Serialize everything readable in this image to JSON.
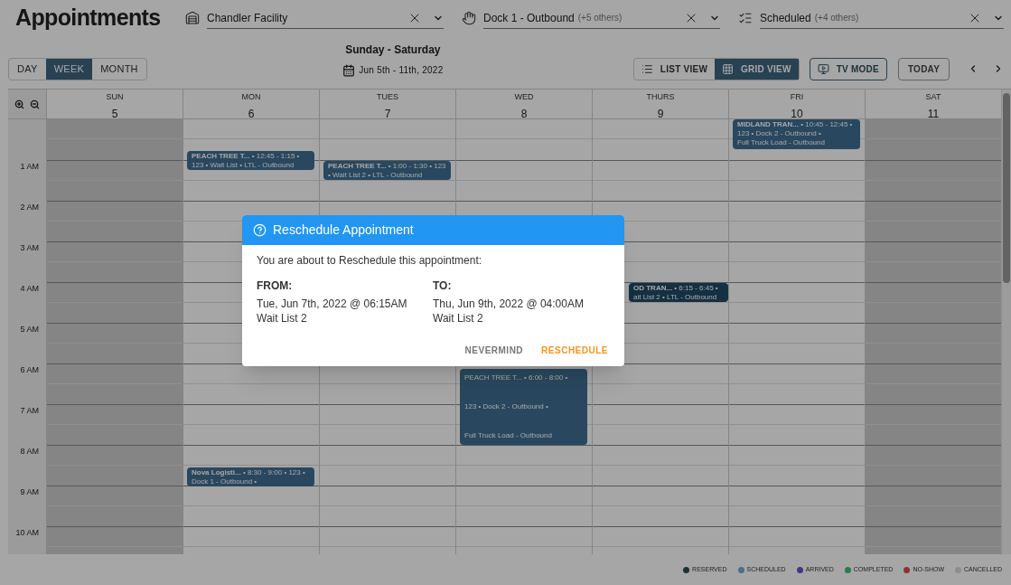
{
  "title": "Appointments",
  "filters": [
    {
      "kind": "facility",
      "value": "Chandler Facility"
    },
    {
      "kind": "dock",
      "value": "Dock 1 - Outbound",
      "extra": "(+5 others)"
    },
    {
      "kind": "status",
      "value": "Scheduled",
      "extra": "(+4 others)"
    }
  ],
  "range_tabs": [
    {
      "label": "DAY",
      "selected": false
    },
    {
      "label": "WEEK",
      "selected": true
    },
    {
      "label": "MONTH",
      "selected": false
    }
  ],
  "range_title": "Sunday - Saturday",
  "range_dates": "Jun 5th - 11th, 2022",
  "view_tabs": [
    {
      "kind": "list",
      "label": "LIST VIEW",
      "selected": false
    },
    {
      "kind": "grid",
      "label": "GRID VIEW",
      "selected": true
    }
  ],
  "tv_mode": "TV MODE",
  "today": "TODAY",
  "days": [
    {
      "name": "SUN",
      "date": "5",
      "closed": true
    },
    {
      "name": "MON",
      "date": "6",
      "closed": false
    },
    {
      "name": "TUES",
      "date": "7",
      "closed": false
    },
    {
      "name": "WED",
      "date": "8",
      "closed": false
    },
    {
      "name": "THURS",
      "date": "9",
      "closed": false
    },
    {
      "name": "FRI",
      "date": "10",
      "closed": false
    },
    {
      "name": "SAT",
      "date": "11",
      "closed": true
    }
  ],
  "hours": [
    "1 AM",
    "2 AM",
    "3 AM",
    "4 AM",
    "5 AM",
    "6 AM",
    "7 AM",
    "8 AM",
    "9 AM",
    "10 AM"
  ],
  "events": [
    {
      "kind": "booked",
      "lines": [
        "**PEACH TREE T...** • 12:45 - 1:15 •",
        "123 • Wait List • LTL - Outbound"
      ]
    },
    {
      "kind": "booked",
      "lines": [
        "**PEACH TREE T...** • 1:00 - 1:30 • 123",
        "• Wait List 2 • LTL - Outbound"
      ]
    },
    {
      "kind": "booked",
      "lines": [
        "**MIDLAND TRAN...** • 10:45 - 12:45 •",
        "123 • Dock 2 - Outbound •",
        "Full Truck Load - Outbound"
      ]
    },
    {
      "kind": "moving",
      "lines": [
        "**OD TRAN...** • 6:15 - 6:45 •",
        "ait List 2 • LTL - Outbound"
      ]
    },
    {
      "kind": "booked",
      "lines": [
        "PEACH TREE T... • 6:00 - 8:00 •",
        "123 • Dock 2 - Outbound •",
        "Full Truck Load - Outbound"
      ]
    },
    {
      "kind": "booked",
      "lines": [
        "**Nova Logisti...** • 8:30 - 9:00 • 123 •",
        "Dock 1 - Outbound •"
      ]
    }
  ],
  "legend": [
    {
      "label": "RESERVED",
      "color": "#1f2f38"
    },
    {
      "label": "SCHEDULED",
      "color": "#4a6f8a"
    },
    {
      "label": "ARRIVED",
      "color": "#3d3b80"
    },
    {
      "label": "COMPLETED",
      "color": "#2f7a48"
    },
    {
      "label": "NO-SHOW",
      "color": "#8a3434"
    },
    {
      "label": "CANCELLED",
      "color": "#8e8e8e"
    }
  ],
  "dialog": {
    "title": "Reschedule Appointment",
    "message": "You are about to Reschedule this appointment:",
    "from": {
      "label": "FROM:",
      "when": "Tue, Jun 7th, 2022 @ 06:15AM",
      "where": "Wait List 2"
    },
    "to": {
      "label": "TO:",
      "when": "Thu, Jun 9th, 2022 @ 04:00AM",
      "where": "Wait List 2"
    },
    "buttons": [
      {
        "kind": "cancel",
        "label": "NEVERMIND"
      },
      {
        "kind": "confirm",
        "label": "RESCHEDULE"
      }
    ]
  }
}
